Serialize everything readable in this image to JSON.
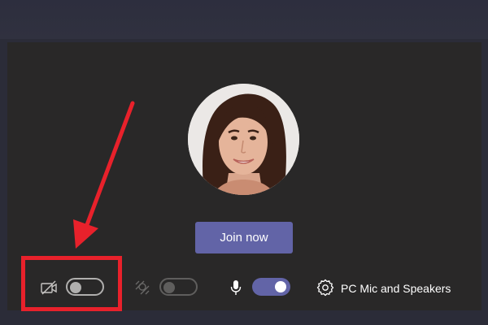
{
  "prejoin": {
    "join_button_label": "Join now",
    "camera_toggle": {
      "state": "off"
    },
    "background_blur_toggle": {
      "state": "off",
      "enabled": false
    },
    "microphone_toggle": {
      "state": "on"
    },
    "audio_device_label": "PC Mic and Speakers"
  },
  "icons": {
    "camera": "camera-off-icon",
    "background": "background-effects-icon",
    "microphone": "microphone-icon",
    "settings": "gear-icon"
  },
  "annotation": {
    "color": "#e8212b",
    "shapes": [
      "arrow",
      "highlight-box"
    ]
  },
  "colors": {
    "accent": "#6264a7",
    "panel": "#292828",
    "frame": "#2e2f3f"
  }
}
